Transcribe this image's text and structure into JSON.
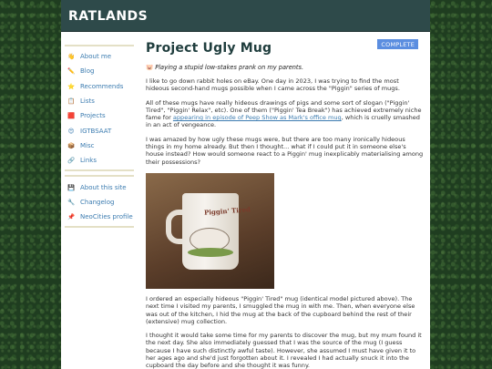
{
  "site": {
    "title": "RATLANDS"
  },
  "sidebar": {
    "groups": [
      {
        "items": [
          {
            "icon": "👋",
            "icon_name": "wave-icon",
            "label": "About me"
          },
          {
            "icon": "✏️",
            "icon_name": "pencil-icon",
            "label": "Blog"
          },
          {
            "icon": "⭐",
            "icon_name": "star-icon",
            "label": "Recommends"
          },
          {
            "icon": "📋",
            "icon_name": "clipboard-icon",
            "label": "Lists"
          },
          {
            "icon": "🟥",
            "icon_name": "projects-icon",
            "label": "Projects"
          },
          {
            "icon": "😍",
            "icon_name": "heart-eyes-icon",
            "label": "IGTBSAAT"
          },
          {
            "icon": "📦",
            "icon_name": "box-icon",
            "label": "Misc"
          },
          {
            "icon": "🔗",
            "icon_name": "link-icon",
            "label": "Links"
          }
        ]
      },
      {
        "items": [
          {
            "icon": "💾",
            "icon_name": "floppy-disk-icon",
            "label": "About this site"
          },
          {
            "icon": "🔧",
            "icon_name": "wrench-icon",
            "label": "Changelog"
          },
          {
            "icon": "📌",
            "icon_name": "pushpin-icon",
            "label": "NeoCities profile"
          }
        ]
      }
    ]
  },
  "main": {
    "status": "COMPLETE",
    "title": "Project Ugly Mug",
    "subtitle": "Playing a stupid low-stakes prank on my parents.",
    "para1": "I like to go down rabbit holes on eBay. One day in 2023, I was trying to find the most hideous second-hand mugs possible when I came across the \"Piggin\" series of mugs.",
    "para2_before": "All of these mugs have really hideous drawings of pigs and some sort of slogan (\"Piggin' Tired\", \"Piggin' Relax\", etc). One of them (\"Piggin' Tea Break\") has achieved extremely niche fame for ",
    "para2_link": "appearing in episode of Peep Show as Mark's office mug",
    "para2_after": ", which is cruelly smashed in an act of vengeance.",
    "para3": "I was amazed by how ugly these mugs were, but there are too many ironically hideous things in my home already. But then I thought... what if I could put it in someone else's house instead? How would someone react to a Piggin' mug inexplicably materialising among their possessions?",
    "photo_text": "Piggin' Tired",
    "para4": "I ordered an especially hideous \"Piggin' Tired\" mug (identical model pictured above). The next time I visited my parents, I smuggled the mug in with me. Then, when everyone else was out of the kitchen, I hid the mug at the back of the cupboard behind the rest of their (extensive) mug collection.",
    "para5": "I thought it would take some time for my parents to discover the mug, but my mum found it the next day. She also immediately guessed that I was the source of the mug (I guess because I have such distinctly awful taste). However, she assumed I must have given it to her ages ago and she'd just forgotten about it. I revealed I had actually snuck it into the cupboard the day before and she thought it was funny."
  },
  "colors": {
    "header_bg": "#2e4a4a",
    "link": "#3c7cb0",
    "badge_bg": "#5b8ee0",
    "title": "#1f3d3d"
  }
}
